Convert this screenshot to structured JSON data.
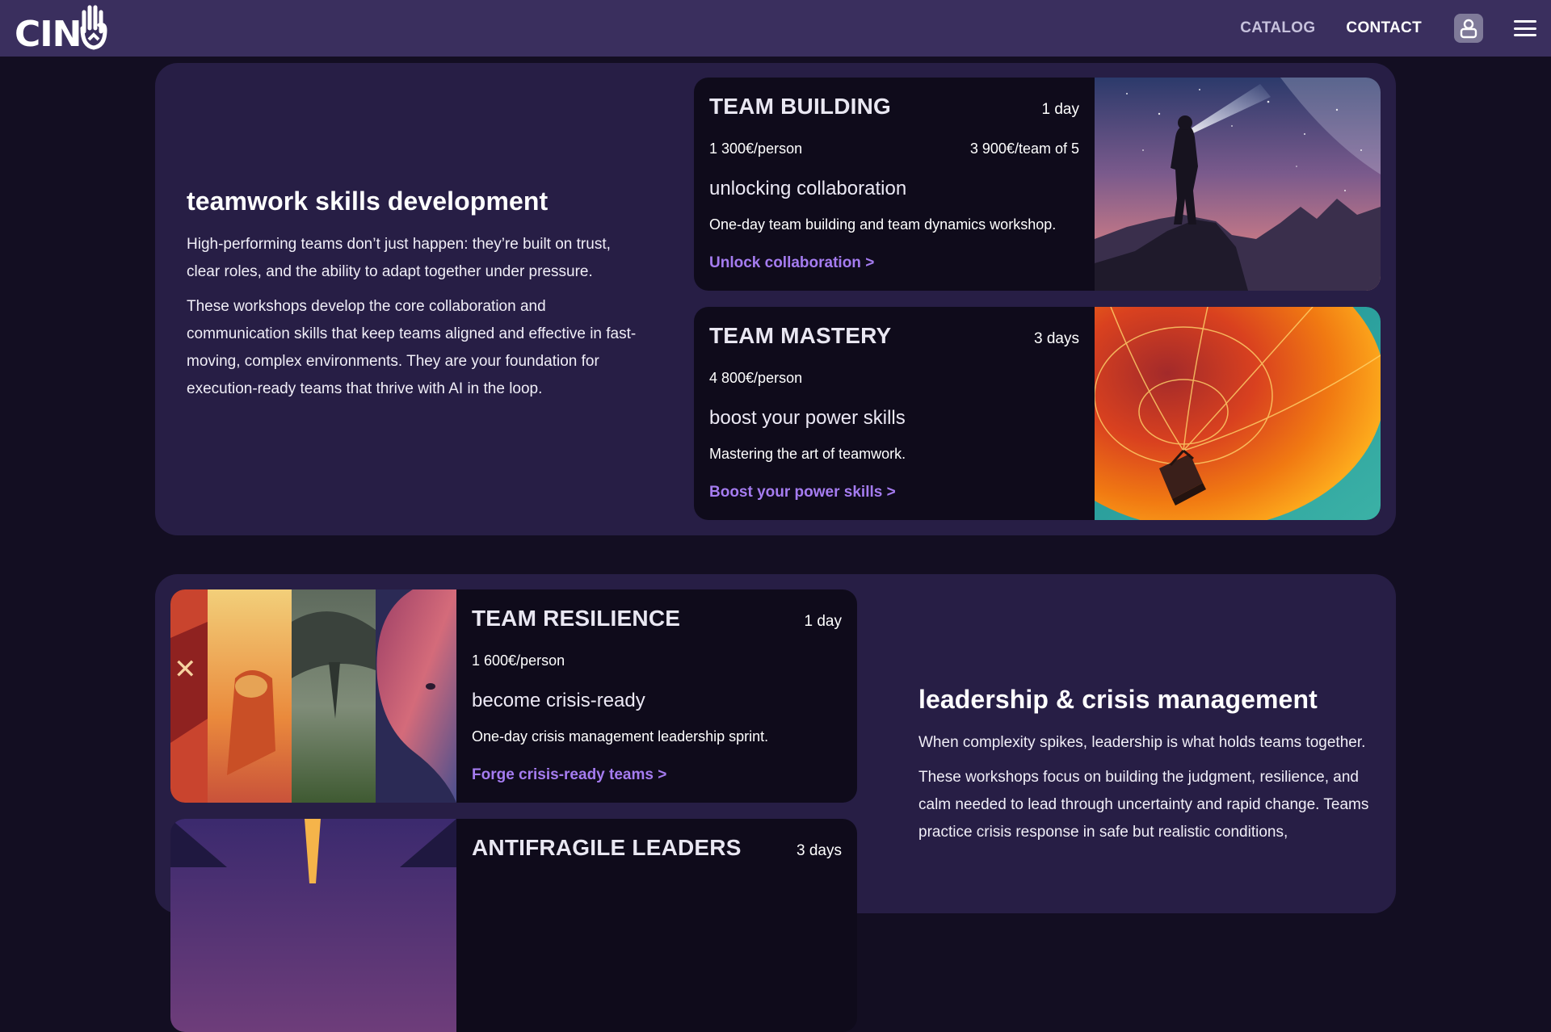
{
  "header": {
    "logo_text": "CIN",
    "nav": {
      "catalog": "CATALOG",
      "contact": "CONTACT"
    },
    "icons": {
      "account": "user-icon",
      "menu": "hamburger-menu-icon"
    }
  },
  "section_teamwork": {
    "title": "teamwork skills development",
    "paragraphs": [
      "High-performing teams don’t just happen: they’re built on trust, clear roles, and the ability to adapt together under pressure.",
      "These workshops develop the core collaboration and communication skills that keep teams aligned and effective in fast-moving, complex environments. They are your foundation for execution-ready teams that thrive with AI in the loop."
    ],
    "cards": [
      {
        "title": "TEAM BUILDING",
        "duration": "1 day",
        "price": "1 300€/person",
        "price_team": "3 900€/team of 5",
        "subtitle": "unlocking collaboration",
        "description": "One-day team building and team dynamics workshop.",
        "link": "Unlock collaboration >"
      },
      {
        "title": "TEAM MASTERY",
        "duration": "3 days",
        "price": "4 800€/person",
        "subtitle": "boost your power skills",
        "description": "Mastering the art of teamwork.",
        "link": "Boost your power skills >"
      }
    ]
  },
  "section_leadership": {
    "title": "leadership & crisis management",
    "paragraphs": [
      "When complexity spikes, leadership is what holds teams together.",
      "These workshops focus on building the judgment, resilience, and calm needed to lead through uncertainty and rapid change. Teams practice crisis response in safe but realistic conditions,"
    ],
    "cards": [
      {
        "title": "TEAM RESILIENCE",
        "duration": "1 day",
        "price": "1 600€/person",
        "subtitle": "become crisis-ready",
        "description": "One-day crisis management leadership sprint.",
        "link": "Forge crisis-ready teams >"
      },
      {
        "title": "ANTIFRAGILE LEADERS",
        "duration": "3 days"
      }
    ]
  },
  "colors": {
    "header_bg": "#3a2f5e",
    "page_bg": "#130e22",
    "panel_bg": "#271e45",
    "card_bg": "#0f0b1b",
    "link": "#a57cf0"
  }
}
